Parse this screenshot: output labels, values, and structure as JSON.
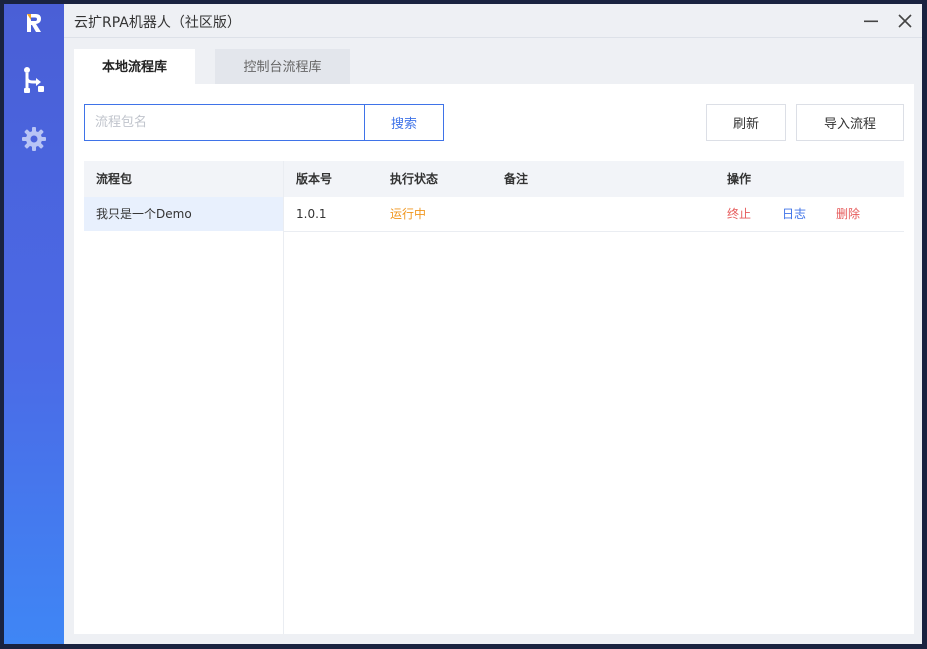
{
  "app": {
    "title": "云扩RPA机器人（社区版）"
  },
  "colors": {
    "accent": "#3f73e8",
    "status_running": "#f0961e",
    "danger": "#e65a5a"
  },
  "sidebar": {
    "items": [
      {
        "icon": "flow-icon"
      },
      {
        "icon": "gear-icon"
      }
    ]
  },
  "tabs": [
    {
      "label": "本地流程库",
      "active": true
    },
    {
      "label": "控制台流程库",
      "active": false
    }
  ],
  "toolbar": {
    "search_placeholder": "流程包名",
    "search_label": "搜索",
    "refresh_label": "刷新",
    "import_label": "导入流程"
  },
  "packages": {
    "header": "流程包",
    "items": [
      "我只是一个Demo"
    ]
  },
  "table": {
    "headers": {
      "version": "版本号",
      "status": "执行状态",
      "note": "备注",
      "actions": "操作"
    },
    "rows": [
      {
        "version": "1.0.1",
        "status": "运行中",
        "note": "",
        "stop": "终止",
        "log": "日志",
        "delete": "删除"
      }
    ]
  }
}
